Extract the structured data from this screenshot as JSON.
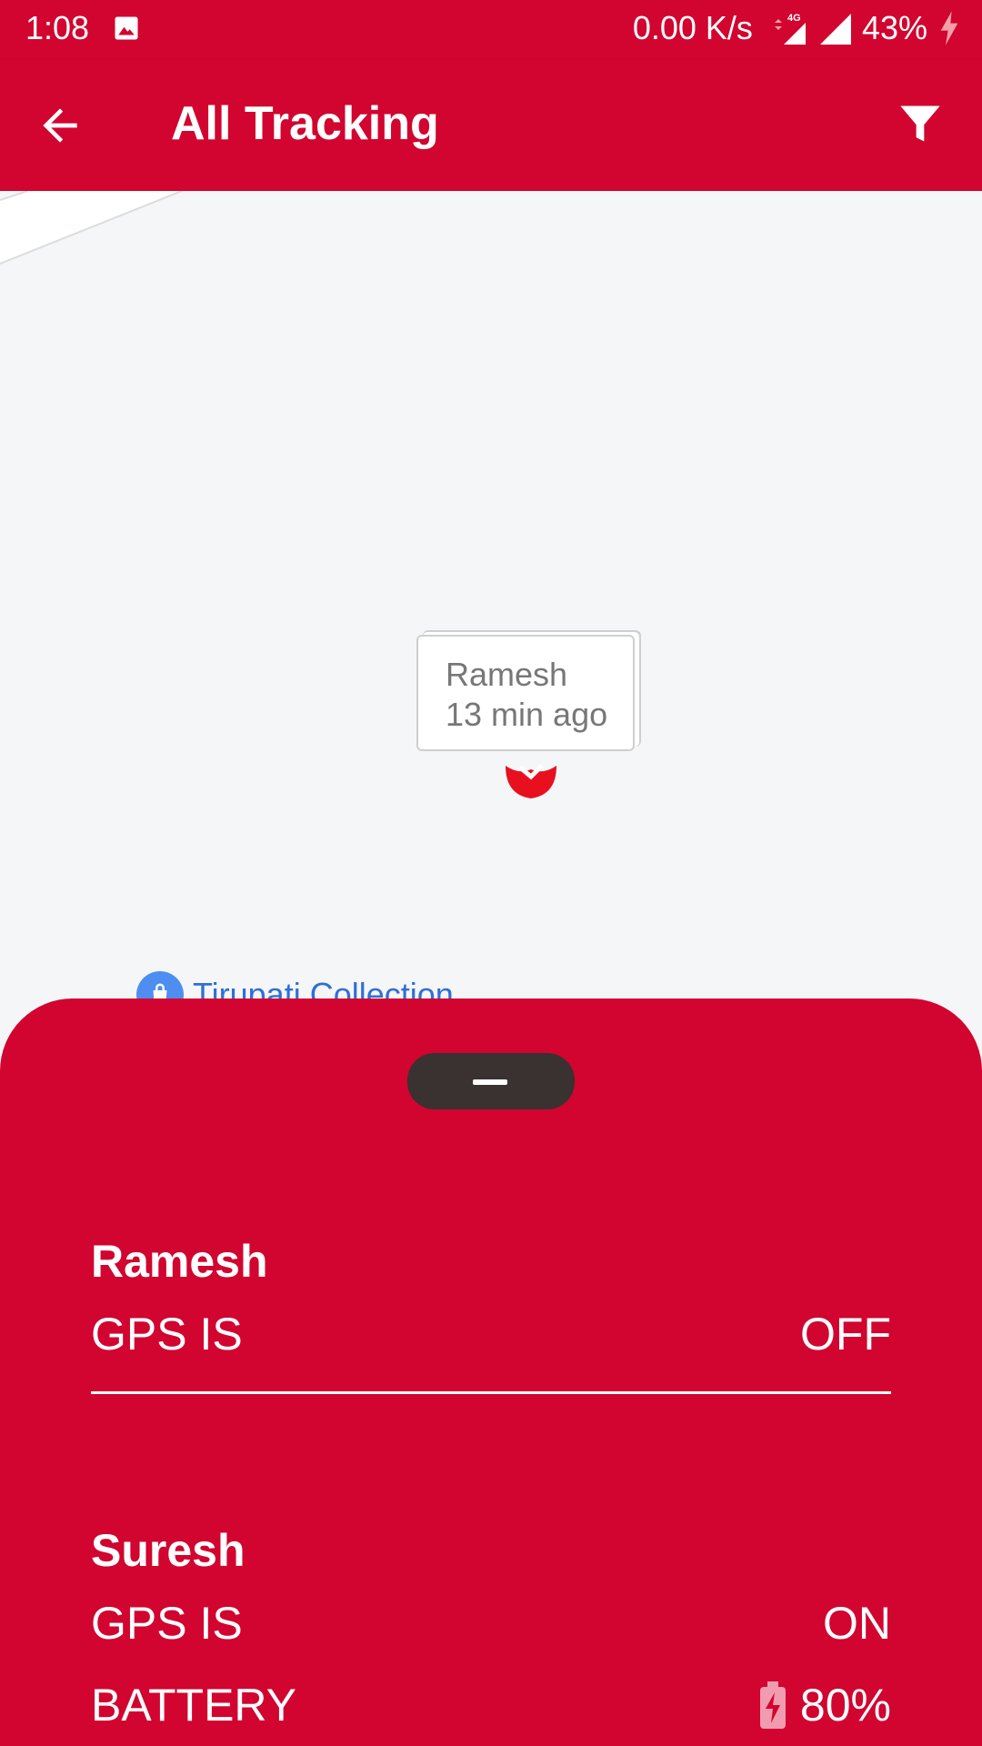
{
  "status_bar": {
    "time": "1:08",
    "speed": "0.00 K/s",
    "network_label": "4G",
    "battery": "43%"
  },
  "app_bar": {
    "title": "All Tracking",
    "back_icon": "arrow-left-icon",
    "filter_icon": "filter-icon"
  },
  "map": {
    "marker": {
      "name": "Ramesh",
      "time": "13 min ago",
      "pin_color": "#e8101e"
    },
    "poi": {
      "label": "Tirupati Collection",
      "icon": "shopping-bag-icon"
    }
  },
  "bottom_sheet": {
    "devices": [
      {
        "name": "Ramesh",
        "gps_label": "GPS IS",
        "gps_value": "OFF"
      },
      {
        "name": "Suresh",
        "gps_label": "GPS IS",
        "gps_value": "ON",
        "battery_label": "BATTERY",
        "battery_value": "80%"
      }
    ]
  },
  "colors": {
    "brand": "#d1052f",
    "handle": "#3a3131",
    "map_bg": "#f5f6f8",
    "poi_text": "#2f6fd6"
  }
}
